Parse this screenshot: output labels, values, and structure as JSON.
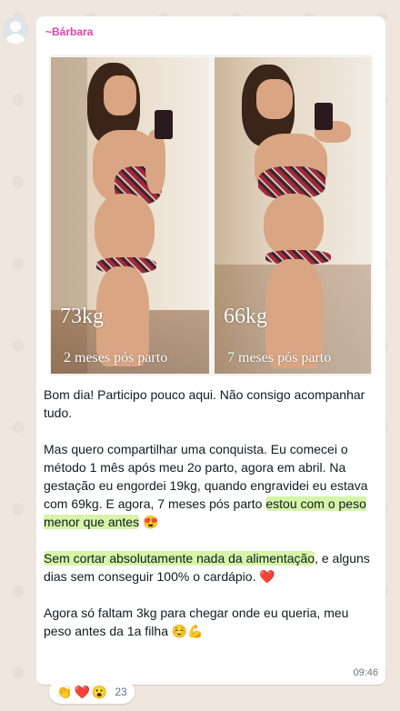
{
  "sender": "~Bárbara",
  "photos": [
    {
      "weight": "73kg",
      "caption": "2 meses pós parto"
    },
    {
      "weight": "66kg",
      "caption": "7 meses pós parto"
    }
  ],
  "message": {
    "p1": "Bom dia! Participo pouco aqui. Não consigo acompanhar tudo.",
    "p2_start": "Mas quero compartilhar uma conquista. Eu comecei o método 1 mês após meu 2o parto, agora em abril. Na gestação eu engordei 19kg, quando engravidei eu estava com 69kg. E agora, 7 meses pós parto ",
    "p2_highlight": "estou com o peso menor que antes",
    "p2_end": " 😍",
    "p3_highlight": "Sem cortar absolutamente nada da alimentação",
    "p3_end": ", e alguns dias sem conseguir 100% o cardápio. ❤️",
    "p4": "Agora só faltam 3kg para chegar onde eu queria, meu peso antes da 1a filha ☺️💪"
  },
  "time": "09:46",
  "reactions": {
    "emojis": [
      "👏",
      "❤️",
      "😮"
    ],
    "count": "23"
  }
}
